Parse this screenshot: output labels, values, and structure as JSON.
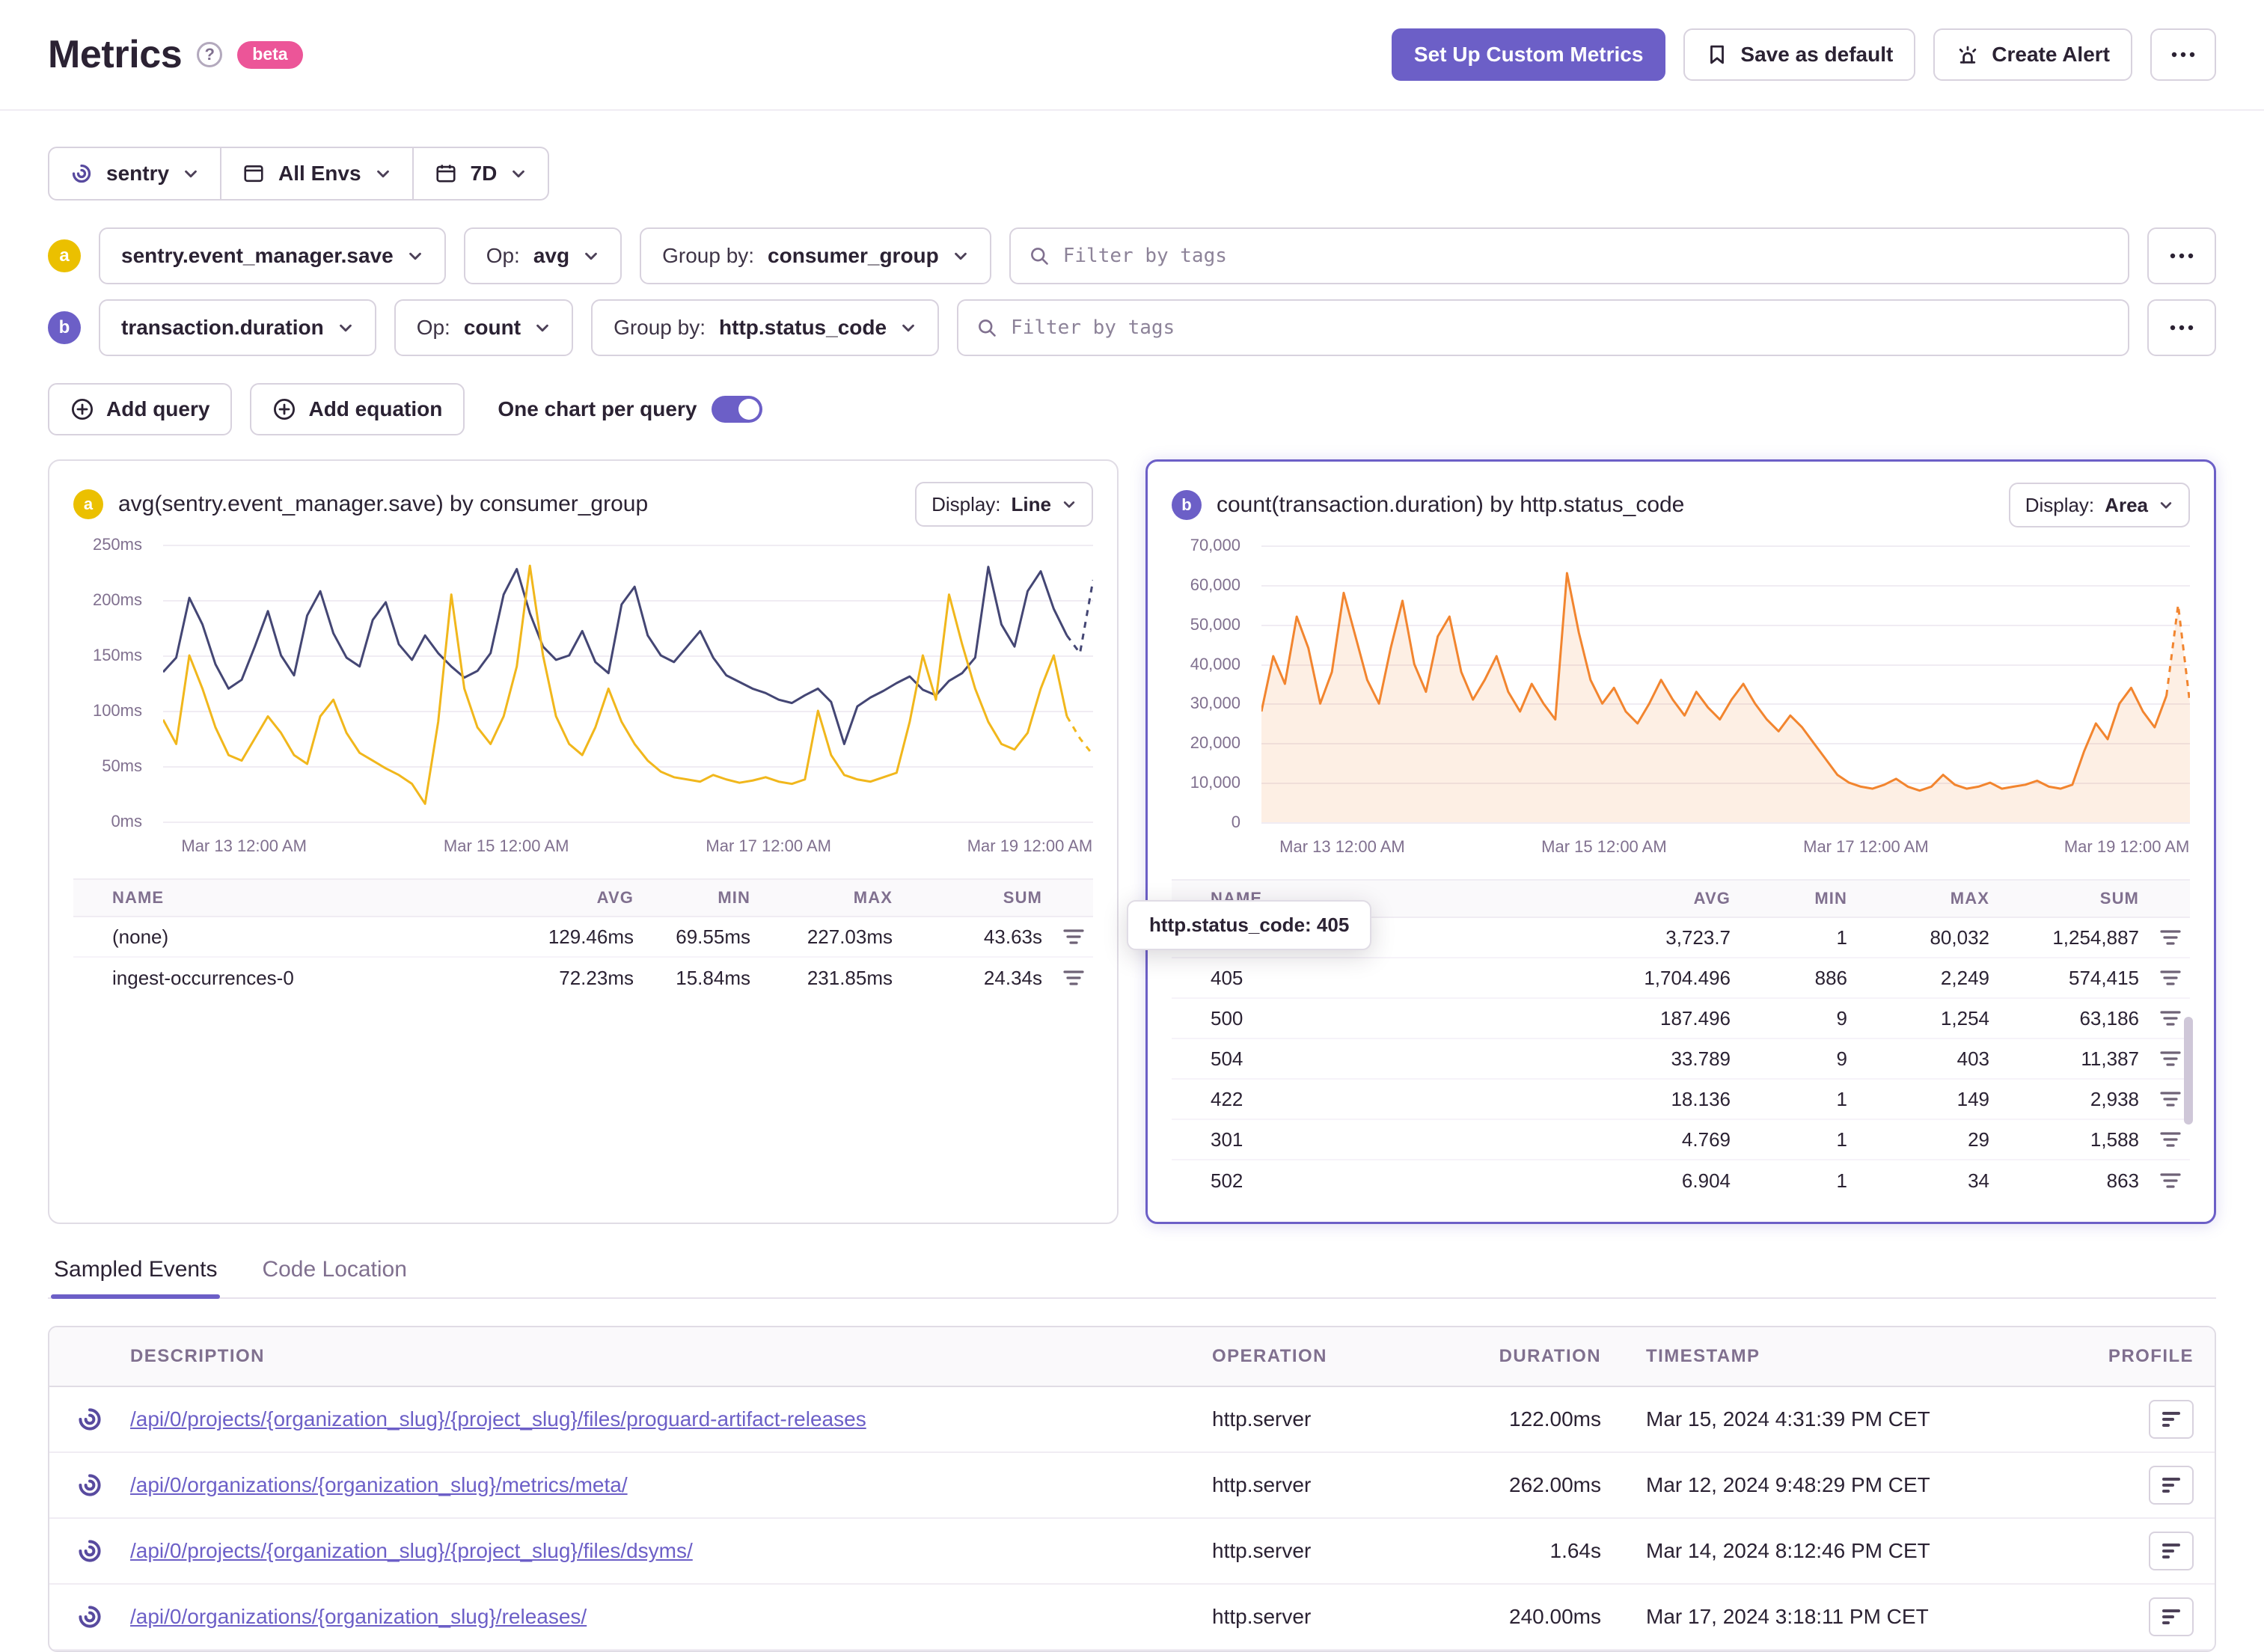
{
  "colors": {
    "accent": "#6c5fc7",
    "beta": "#ec5598",
    "text": "#2b2233",
    "muted": "#80708f",
    "logo": "#584a9f"
  },
  "header": {
    "title": "Metrics",
    "beta": "beta",
    "setup_button": "Set Up Custom Metrics",
    "save_default_button": "Save as default",
    "create_alert_button": "Create Alert"
  },
  "filter_bar": {
    "project": "sentry",
    "environment": "All Envs",
    "date_range": "7D"
  },
  "queries": [
    {
      "letter": "a",
      "badge_color": "#ebc000",
      "metric": "sentry.event_manager.save",
      "op_label": "Op:",
      "op_value": "avg",
      "group_label": "Group by:",
      "group_value": "consumer_group",
      "filter_placeholder": "Filter by tags"
    },
    {
      "letter": "b",
      "badge_color": "#6c5fc7",
      "metric": "transaction.duration",
      "op_label": "Op:",
      "op_value": "count",
      "group_label": "Group by:",
      "group_value": "http.status_code",
      "filter_placeholder": "Filter by tags"
    }
  ],
  "actions": {
    "add_query": "Add query",
    "add_equation": "Add equation",
    "one_chart_per_query": "One chart per query",
    "toggle_on": true
  },
  "panels": [
    {
      "badge": "a",
      "badge_color": "#ebc000",
      "display_label": "Display:",
      "display_value": "Line"
    },
    {
      "badge": "b",
      "badge_color": "#6c5fc7",
      "display_label": "Display:",
      "display_value": "Area",
      "tooltip": "http.status_code: 405"
    }
  ],
  "chart_data": [
    {
      "type": "line",
      "title": "avg(sentry.event_manager.save) by consumer_group",
      "unit": "ms",
      "ylim": [
        0,
        250
      ],
      "yticks": [
        "0ms",
        "50ms",
        "100ms",
        "150ms",
        "200ms",
        "250ms"
      ],
      "xticks": [
        "Mar 13 12:00 AM",
        "Mar 15 12:00 AM",
        "Mar 17 12:00 AM",
        "Mar 19 12:00 AM"
      ],
      "grid": true,
      "legend_position": "table-below",
      "series": [
        {
          "name": "(none)",
          "color": "#444674",
          "values": [
            135,
            148,
            202,
            178,
            142,
            120,
            128,
            158,
            190,
            150,
            132,
            186,
            208,
            170,
            148,
            140,
            182,
            198,
            160,
            146,
            168,
            152,
            140,
            130,
            136,
            152,
            205,
            228,
            188,
            158,
            146,
            150,
            172,
            144,
            134,
            196,
            212,
            168,
            150,
            144,
            158,
            172,
            148,
            132,
            126,
            120,
            116,
            110,
            107,
            114,
            120,
            108,
            70,
            104,
            112,
            118,
            125,
            131,
            119,
            114,
            127,
            134,
            148,
            230,
            178,
            158,
            208,
            226,
            192,
            168,
            152,
            218
          ]
        },
        {
          "name": "ingest-occurrences-0",
          "color": "#f1b71c",
          "values": [
            92,
            70,
            150,
            120,
            85,
            60,
            55,
            75,
            95,
            80,
            60,
            52,
            95,
            110,
            80,
            62,
            55,
            48,
            42,
            34,
            16,
            90,
            205,
            120,
            85,
            70,
            95,
            140,
            231,
            150,
            95,
            70,
            60,
            85,
            120,
            90,
            70,
            55,
            45,
            40,
            38,
            36,
            42,
            38,
            35,
            37,
            40,
            36,
            34,
            38,
            100,
            60,
            42,
            38,
            36,
            40,
            44,
            90,
            150,
            110,
            205,
            160,
            120,
            90,
            70,
            65,
            80,
            120,
            150,
            95,
            75,
            60
          ]
        }
      ],
      "legend_table": {
        "headers": [
          "NAME",
          "AVG",
          "MIN",
          "MAX",
          "SUM"
        ],
        "rows": [
          {
            "name": "(none)",
            "color": "#444674",
            "values": [
              "129.46ms",
              "69.55ms",
              "227.03ms",
              "43.63s"
            ]
          },
          {
            "name": "ingest-occurrences-0",
            "color": "#f1b71c",
            "values": [
              "72.23ms",
              "15.84ms",
              "231.85ms",
              "24.34s"
            ]
          }
        ]
      }
    },
    {
      "type": "area",
      "title": "count(transaction.duration) by http.status_code",
      "unit": "count",
      "ylim": [
        0,
        70000
      ],
      "yticks": [
        "0",
        "10,000",
        "20,000",
        "30,000",
        "40,000",
        "50,000",
        "60,000",
        "70,000"
      ],
      "xticks": [
        "Mar 13 12:00 AM",
        "Mar 15 12:00 AM",
        "Mar 17 12:00 AM",
        "Mar 19 12:00 AM"
      ],
      "grid": true,
      "legend_position": "table-below",
      "series": [
        {
          "name": "405",
          "color": "#f2852f",
          "values": [
            28000,
            42000,
            35000,
            52000,
            44000,
            30000,
            38000,
            58000,
            47000,
            36000,
            30000,
            44000,
            56000,
            40000,
            33000,
            47000,
            52000,
            38000,
            31000,
            36000,
            42000,
            33000,
            28000,
            35000,
            30000,
            26000,
            63000,
            48000,
            36000,
            30000,
            34000,
            28000,
            25000,
            30000,
            36000,
            31000,
            27000,
            33000,
            29000,
            26000,
            31000,
            35000,
            30000,
            26000,
            23000,
            27000,
            24000,
            20000,
            16000,
            12000,
            10000,
            9000,
            8500,
            9500,
            11000,
            9000,
            8000,
            9000,
            12000,
            9500,
            8500,
            9000,
            10000,
            8500,
            9000,
            9500,
            10500,
            9000,
            8500,
            9500,
            18000,
            25000,
            21000,
            30000,
            34000,
            28000,
            24000,
            32000,
            55000,
            30000
          ]
        }
      ],
      "legend_table": {
        "headers": [
          "NAME",
          "AVG",
          "MIN",
          "MAX",
          "SUM"
        ],
        "rows": [
          {
            "name": "",
            "color": "",
            "values": [
              "3,723.7",
              "1",
              "80,032",
              "1,254,887"
            ]
          },
          {
            "name": "405",
            "color": "#f2852f",
            "values": [
              "1,704.496",
              "886",
              "2,249",
              "574,415"
            ]
          },
          {
            "name": "500",
            "color": "#f2852f",
            "values": [
              "187.496",
              "9",
              "1,254",
              "63,186"
            ]
          },
          {
            "name": "504",
            "color": "#f2852f",
            "values": [
              "33.789",
              "9",
              "403",
              "11,387"
            ]
          },
          {
            "name": "422",
            "color": "#f1b71c",
            "values": [
              "18.136",
              "1",
              "149",
              "2,938"
            ]
          },
          {
            "name": "301",
            "color": "#444674",
            "values": [
              "4.769",
              "1",
              "29",
              "1,588"
            ]
          },
          {
            "name": "502",
            "color": "#444674",
            "values": [
              "6.904",
              "1",
              "34",
              "863"
            ]
          }
        ]
      }
    }
  ],
  "tabs": [
    {
      "label": "Sampled Events",
      "active": true
    },
    {
      "label": "Code Location",
      "active": false
    }
  ],
  "events_table": {
    "headers": [
      "DESCRIPTION",
      "OPERATION",
      "DURATION",
      "TIMESTAMP",
      "PROFILE"
    ],
    "rows": [
      {
        "description": "/api/0/projects/{organization_slug}/{project_slug}/files/proguard-artifact-releases",
        "operation": "http.server",
        "duration": "122.00ms",
        "timestamp": "Mar 15, 2024 4:31:39 PM CET"
      },
      {
        "description": "/api/0/organizations/{organization_slug}/metrics/meta/",
        "operation": "http.server",
        "duration": "262.00ms",
        "timestamp": "Mar 12, 2024 9:48:29 PM CET"
      },
      {
        "description": "/api/0/projects/{organization_slug}/{project_slug}/files/dsyms/",
        "operation": "http.server",
        "duration": "1.64s",
        "timestamp": "Mar 14, 2024 8:12:46 PM CET"
      },
      {
        "description": "/api/0/organizations/{organization_slug}/releases/",
        "operation": "http.server",
        "duration": "240.00ms",
        "timestamp": "Mar 17, 2024 3:18:11 PM CET"
      }
    ]
  }
}
